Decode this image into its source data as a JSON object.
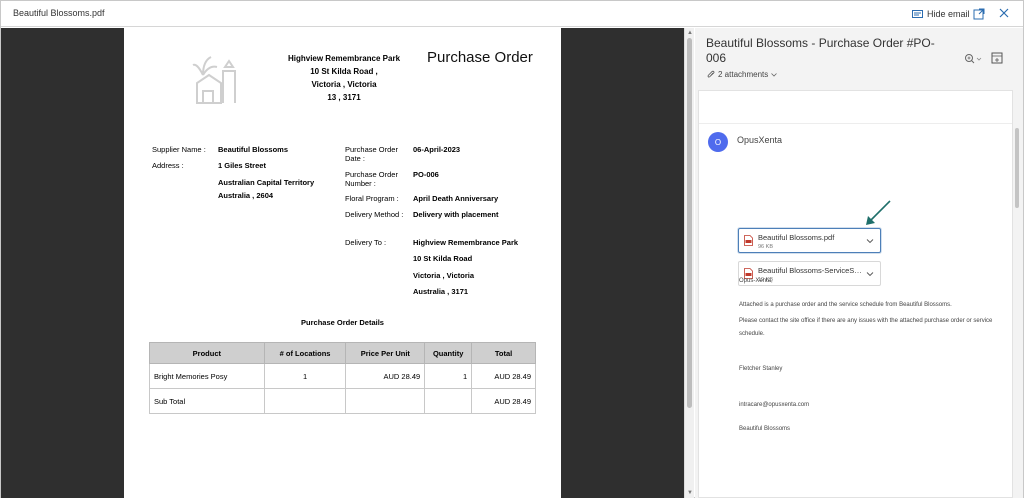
{
  "window": {
    "title": "Beautiful Blossoms.pdf",
    "hide_email": "Hide email"
  },
  "pdf": {
    "address_lines": [
      "Highview Remembrance Park",
      "10 St Kilda Road ,",
      "Victoria , Victoria",
      "13 , 3171"
    ],
    "doc_title": "Purchase Order",
    "supplier_name_label": "Supplier Name :",
    "supplier_name": "Beautiful Blossoms",
    "address_label": "Address :",
    "supplier_address": [
      "1 Giles Street",
      "Australian Capital Territory",
      "Australia , 2604"
    ],
    "po_date_label": [
      "Purchase Order",
      "Date :"
    ],
    "po_date": "06-April-2023",
    "po_number_label": [
      "Purchase Order",
      "Number :"
    ],
    "po_number": "PO-006",
    "floral_program_label": "Floral Program :",
    "floral_program": "April Death Anniversary",
    "delivery_method_label": "Delivery Method :",
    "delivery_method": "Delivery with placement",
    "delivery_to_label": "Delivery To :",
    "delivery_to": [
      "Highview Remembrance Park",
      "10 St Kilda Road",
      "Victoria , Victoria",
      "Australia , 3171"
    ],
    "details_title": "Purchase Order Details",
    "table": {
      "headers": [
        "Product",
        "# of Locations",
        "Price Per Unit",
        "Quantity",
        "Total"
      ],
      "rows": [
        [
          "Bright Memories Posy",
          "1",
          "AUD 28.49",
          "1",
          "AUD 28.49"
        ],
        [
          "Sub Total",
          "",
          "",
          "",
          "AUD 28.49"
        ]
      ]
    }
  },
  "email": {
    "subject": "Beautiful Blossoms - Purchase Order #PO-006",
    "attachments_count": "2 attachments",
    "sender_initial": "O",
    "sender": "OpusXenta",
    "attachments": [
      {
        "name": "Beautiful Blossoms.pdf",
        "size": "96 KB",
        "selected": true
      },
      {
        "name": "Beautiful Blossoms-ServiceSc...",
        "size": "19 KB",
        "selected": false
      }
    ],
    "body": {
      "greeting": "Opus-Xenta,",
      "line1": "Attached is a purchase order and the service schedule from Beautiful Blossoms.",
      "line2": "Please contact the site office if there are any issues with the attached purchase order or service schedule.",
      "signature_name": "Fletcher Stanley",
      "signature_email": "intracare@opusxenta.com",
      "signature_company": "Beautiful Blossoms"
    },
    "accent_color": "#4f6bed",
    "arrow_color": "#1f6f6a"
  }
}
